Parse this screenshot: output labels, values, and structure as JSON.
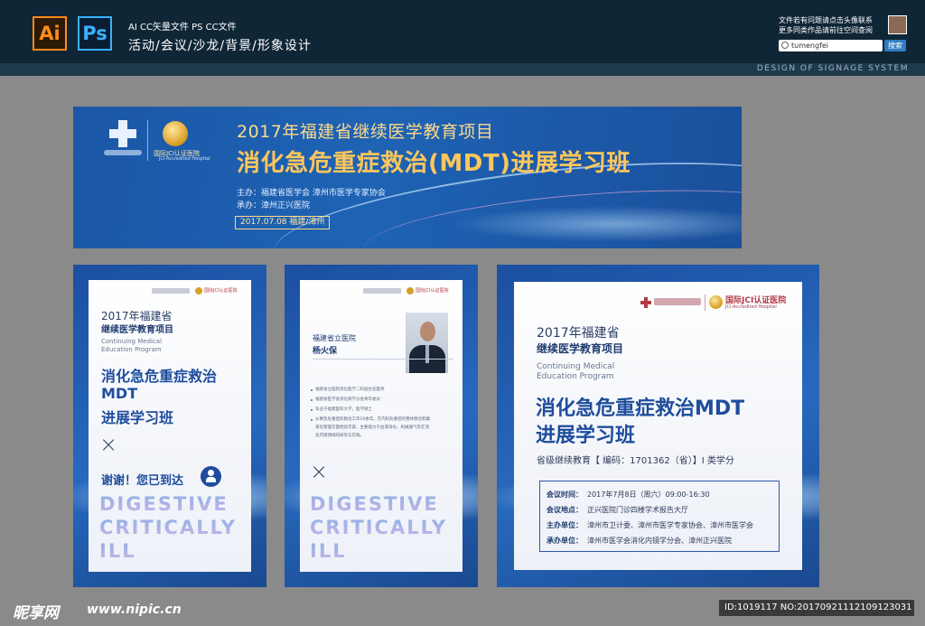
{
  "header": {
    "app_badges": [
      "Ai",
      "Ps"
    ],
    "formats": "AI CC矢量文件  PS CC文件",
    "categories": "活动/会议/沙龙/背景/形象设计",
    "note_line1": "文件若有问题请点击头像联系",
    "note_line2": "更多同类作品请前往空间查阅",
    "search_value": "tumengfei",
    "search_button": "搜索",
    "strip_text": "DESIGN OF SIGNAGE SYSTEM"
  },
  "banner": {
    "jci_name": "国际JCI认证医院",
    "jci_sub": "JCI-Accredited Hospital",
    "subtitle": "2017年福建省继续医学教育项目",
    "title": "消化急危重症救治(MDT)进展学习班",
    "host": "主办：福建省医学会    漳州市医学专家协会",
    "organizer": "承办：漳州正兴医院",
    "date_location": "2017.07.08  福建/漳州"
  },
  "poster_left": {
    "jci": "国际JCI认证医院",
    "year": "2017年福建省",
    "category": "继续医学教育项目",
    "en_line1": "Continuing Medical",
    "en_line2": "Education Program",
    "title_line1": "消化急危重症救治",
    "title_line2": "MDT",
    "title_line3": "进展学习班",
    "x_mark": "×",
    "thanks": "谢谢！您已到达",
    "en_big_1": "DIGESTIVE",
    "en_big_2": "CRITICALLY",
    "en_big_3": "ILL"
  },
  "poster_middle": {
    "jci": "国际JCI认证医院",
    "hospital": "福建省立医院",
    "name": "杨火保",
    "bio": [
      "福建省立医院消化医学二科副主任医师",
      "福建省医学会消化病学分会青年委员",
      "毕业于福建医科大学，医学硕士",
      "从事急危重症的救治工作10余年。在内科危重症的整体救治和集",
      "束化管理方面经验丰富，主要能力于血液净化、机械通气及在消",
      "化内镜领域的研究与实践。"
    ],
    "x_mark": "×",
    "en_big_1": "DIGESTIVE",
    "en_big_2": "CRITICALLY",
    "en_big_3": "ILL"
  },
  "poster_right": {
    "jci": "国际JCI认证医院",
    "jci_sub": "JCI-Accredited Hospital",
    "year": "2017年福建省",
    "category": "继续医学教育项目",
    "en_line1": "Continuing Medical",
    "en_line2": "Education Program",
    "title_line1": "消化急危重症救治MDT",
    "title_line2": "进展学习班",
    "code": "省级继续教育【 编码：1701362（省）】I 类学分",
    "info": [
      {
        "label": "会议时间：",
        "value": "2017年7月8日（周六）09:00-16:30"
      },
      {
        "label": "会议地点：",
        "value": "正兴医院门诊四楼学术报告大厅"
      },
      {
        "label": "主办单位：",
        "value": "漳州市卫计委、漳州市医学专家协会、漳州市医学会"
      },
      {
        "label": "承办单位：",
        "value": "漳州市医学会消化内镜学分会、漳州正兴医院"
      }
    ]
  },
  "footer": {
    "brand": "昵享网",
    "url": "www.nipic.cn",
    "id_text": "ID:1019117 NO:20170921112109123031"
  }
}
